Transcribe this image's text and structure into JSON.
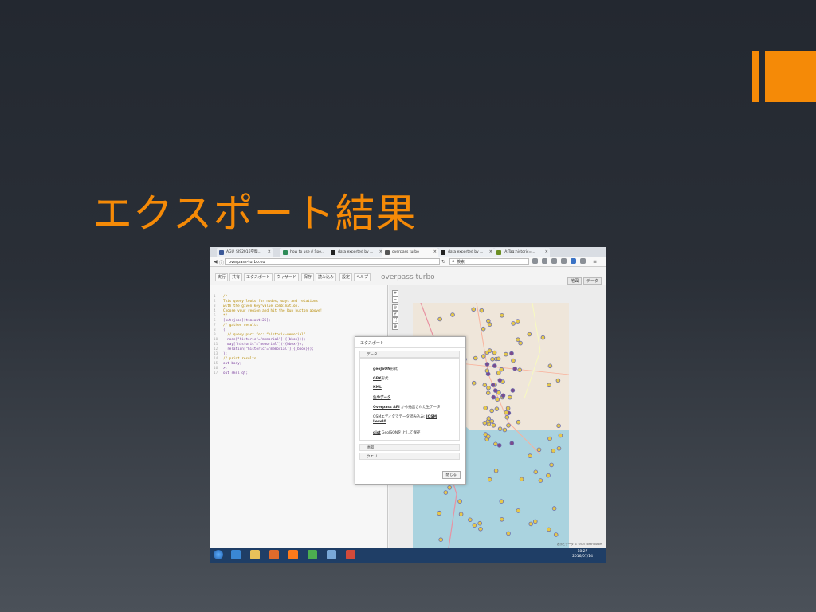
{
  "slide": {
    "title": "エクスポート結果",
    "accent_color": "#f58a07"
  },
  "browser": {
    "tabs": [
      {
        "label": "AGU_SIS2016空間...",
        "icon": "facebook-icon",
        "color": "#3b5998"
      },
      {
        "label": "how to use // Spe...",
        "icon": "spreadsheet-icon",
        "color": "#2e8b57"
      },
      {
        "label": "data exported by ...",
        "icon": "github-icon",
        "color": "#222222"
      },
      {
        "label": "overpass turbo",
        "icon": "overpass-icon",
        "color": "#555555"
      },
      {
        "label": "data exported by ...",
        "icon": "github-icon",
        "color": "#222222"
      },
      {
        "label": "JA:Tag:historic=...",
        "icon": "osm-wiki-icon",
        "color": "#6b8e23"
      }
    ],
    "url": "overpass-turbo.eu",
    "search_placeholder": "検索"
  },
  "toolbar": {
    "buttons": [
      "実行",
      "共有",
      "エクスポート",
      "ウィザード",
      "保存",
      "読み込み",
      "設定",
      "ヘルプ"
    ],
    "brand": "overpass turbo",
    "view_tabs": [
      "地図",
      "データ"
    ]
  },
  "editor": {
    "lines": [
      "/*",
      "This query looks for nodes, ways and relations",
      "with the given key/value combination.",
      "Choose your region and hit the Run button above!",
      "*/",
      "[out:json][timeout:25];",
      "// gather results",
      "(",
      "  // query part for: “historic=memorial”",
      "  node[\"historic\"=\"memorial\"]({{bbox}});",
      "  way[\"historic\"=\"memorial\"]({{bbox}});",
      "  relation[\"historic\"=\"memorial\"]({{bbox}});",
      ");",
      "// print results",
      "out body;",
      ">;",
      "out skel qt;"
    ]
  },
  "dialog": {
    "title": "エクスポート",
    "section_data": "データ",
    "items": [
      {
        "link": "geoJSON",
        "text": "形式"
      },
      {
        "link": "GPX",
        "text": "形式"
      },
      {
        "link": "KML",
        "text": ""
      },
      {
        "link": "生のデータ",
        "text": ""
      },
      {
        "link": "Overpass API",
        "text": " から抽出された生データ"
      },
      {
        "link": "JOSM",
        "text": "OSMエディタでデータ読み込み: "
      },
      {
        "link": "Level0",
        "text": ""
      },
      {
        "link": "gist",
        "text": "GeoJSONを  として保存"
      }
    ],
    "section_map": "地図",
    "section_query": "クエリ",
    "close_label": "閉じる"
  },
  "map": {
    "attribution": "表示とデータ © OSM contributors"
  },
  "taskbar": {
    "time": "18:27",
    "date": "2016/07/14"
  }
}
